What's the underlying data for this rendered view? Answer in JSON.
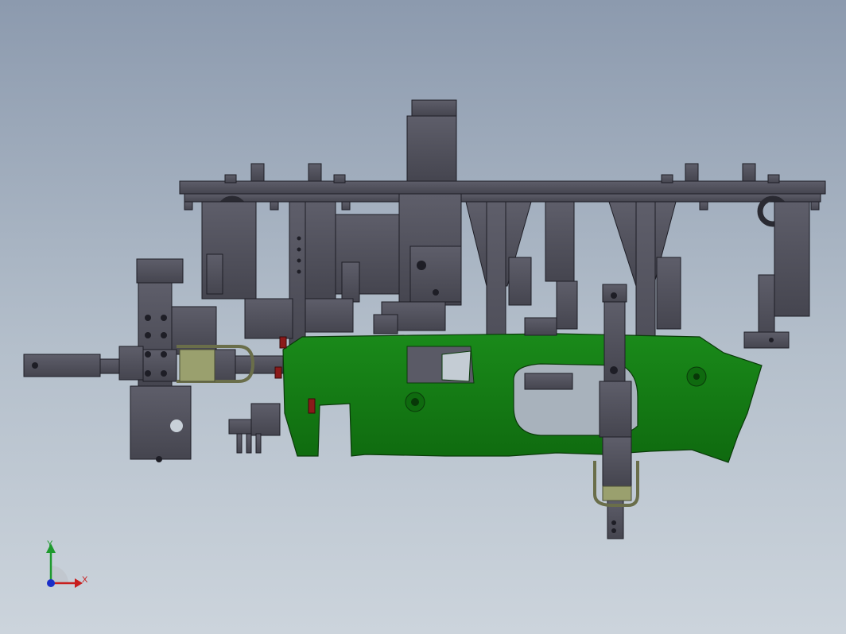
{
  "scene": {
    "background_top": "#8c9aae",
    "background_bottom": "#ccd4dc",
    "fixture_color": "#50505c",
    "fixture_edge": "#1e1e26",
    "part_color": "#137a13",
    "part_edge": "#0a3a0a",
    "clamp_color": "#9aa06e",
    "accent_color": "#8b1a1a"
  },
  "triad": {
    "y_label": "Y",
    "x_label": "X",
    "y_color": "#1e9a2e",
    "x_color": "#c81e1e",
    "z_color": "#1a2ec8"
  }
}
